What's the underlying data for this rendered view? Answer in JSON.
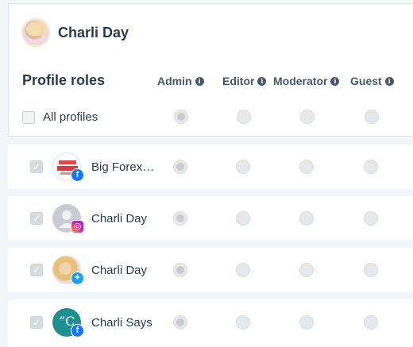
{
  "user": {
    "name": "Charli Day"
  },
  "roles_title": "Profile roles",
  "roles": [
    {
      "label": "Admin",
      "info": "i"
    },
    {
      "label": "Editor",
      "info": "i"
    },
    {
      "label": "Moderator",
      "info": "i"
    },
    {
      "label": "Guest",
      "info": "i"
    }
  ],
  "all_profiles_label": "All profiles",
  "profiles": [
    {
      "name": "Big Forex…",
      "network": "facebook-icon",
      "avatar_text": "THE BIG FOREX"
    },
    {
      "name": "Charli Day",
      "network": "instagram-icon"
    },
    {
      "name": "Charli Day",
      "network": "twitter-icon"
    },
    {
      "name": "Charli Says",
      "network": "facebook-icon"
    }
  ],
  "colors": {
    "facebook": "#1877f2",
    "instagram": "#d6249f",
    "twitter": "#1da1f2",
    "text": "#2c3a4d"
  }
}
